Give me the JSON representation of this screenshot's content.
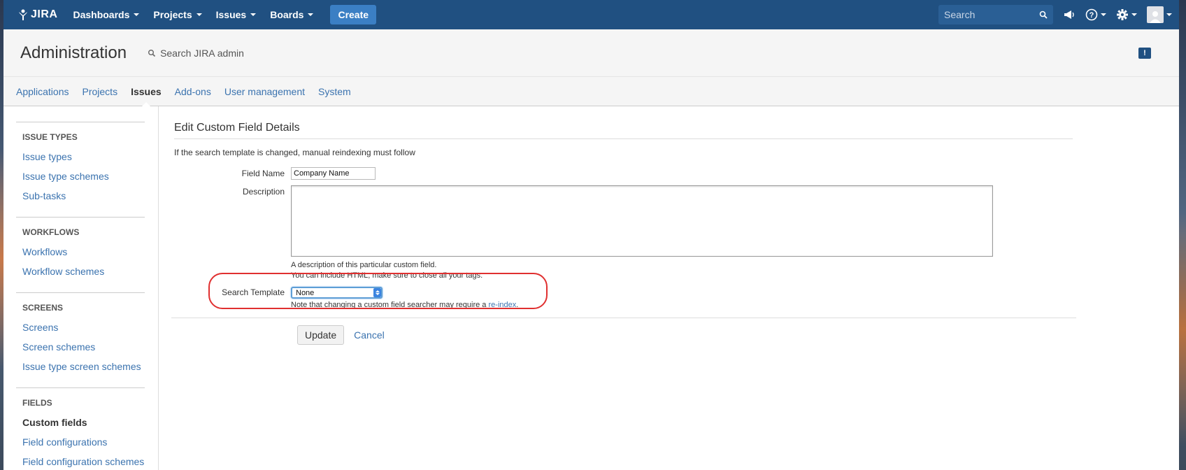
{
  "topnav": {
    "logo_text": "JIRA",
    "items": [
      "Dashboards",
      "Projects",
      "Issues",
      "Boards"
    ],
    "create_label": "Create",
    "search_placeholder": "Search"
  },
  "admin": {
    "title": "Administration",
    "search_label": "Search JIRA admin",
    "feedback_glyph": "!"
  },
  "tabs": [
    {
      "label": "Applications",
      "active": false
    },
    {
      "label": "Projects",
      "active": false
    },
    {
      "label": "Issues",
      "active": true
    },
    {
      "label": "Add-ons",
      "active": false
    },
    {
      "label": "User management",
      "active": false
    },
    {
      "label": "System",
      "active": false
    }
  ],
  "sidebar": {
    "sections": [
      {
        "heading": "ISSUE TYPES",
        "items": [
          "Issue types",
          "Issue type schemes",
          "Sub-tasks"
        ]
      },
      {
        "heading": "WORKFLOWS",
        "items": [
          "Workflows",
          "Workflow schemes"
        ]
      },
      {
        "heading": "SCREENS",
        "items": [
          "Screens",
          "Screen schemes",
          "Issue type screen schemes"
        ]
      },
      {
        "heading": "FIELDS",
        "items": [
          "Custom fields",
          "Field configurations",
          "Field configuration schemes"
        ]
      }
    ],
    "active_item": "Custom fields"
  },
  "form": {
    "heading": "Edit Custom Field Details",
    "warning": "If the search template is changed, manual reindexing must follow",
    "field_name_label": "Field Name",
    "field_name_value": "Company Name",
    "description_label": "Description",
    "description_help_1": "A description of this particular custom field.",
    "description_help_2": "You can include HTML, make sure to close all your tags.",
    "search_template_label": "Search Template",
    "search_template_value": "None",
    "search_template_note": "Note that changing a custom field searcher may require a",
    "reindex_link": "re-index",
    "reindex_suffix": ".",
    "update_label": "Update",
    "cancel_label": "Cancel"
  },
  "colors": {
    "nav_bg": "#205081",
    "link": "#3b73af",
    "highlight_ring": "#e03030"
  }
}
